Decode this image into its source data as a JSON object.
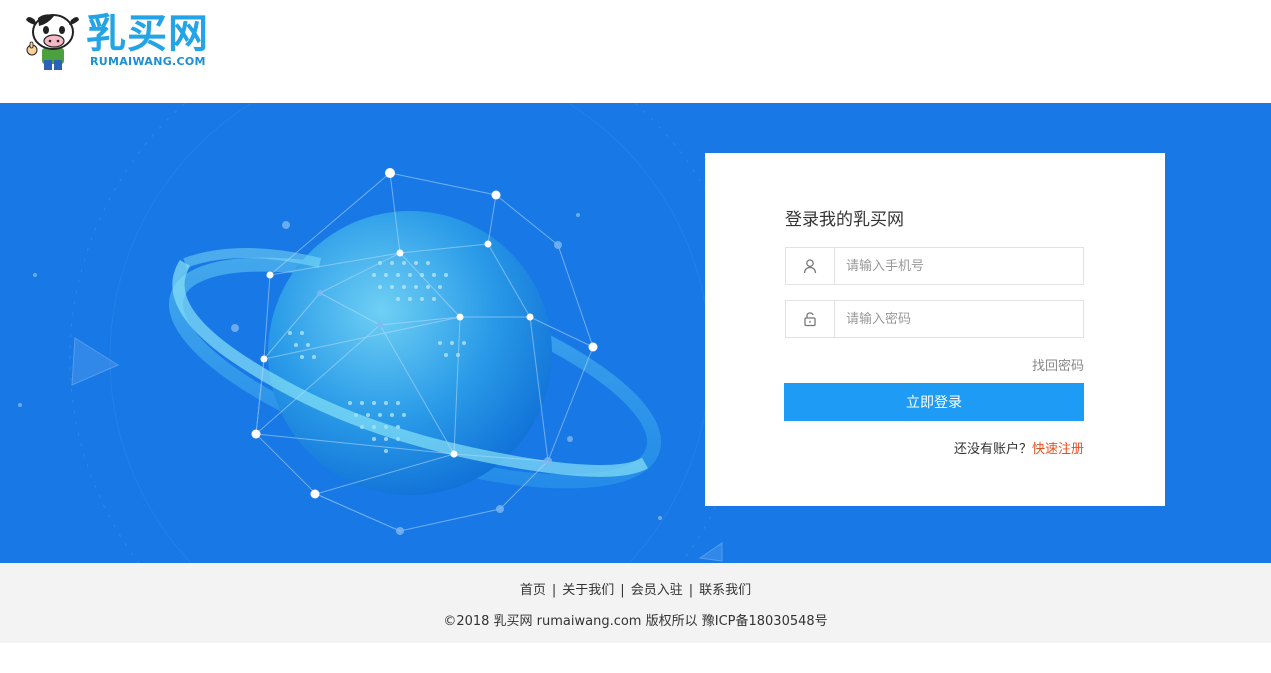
{
  "header": {
    "logo_text": "乳买网",
    "logo_sub": "RUMAIWANG.COM"
  },
  "login": {
    "title": "登录我的乳买网",
    "phone_placeholder": "请输入手机号",
    "password_placeholder": "请输入密码",
    "forgot": "找回密码",
    "submit": "立即登录",
    "no_account": "还没有账户？",
    "register": "快速注册"
  },
  "footer": {
    "nav": [
      "首页",
      "关于我们",
      "会员入驻",
      "联系我们"
    ],
    "copyright": "©2018 乳买网 rumaiwang.com 版权所以 豫ICP备18030548号"
  },
  "colors": {
    "hero_bg": "#1778e6",
    "brand": "#23a4e6",
    "button": "#1e9bf5",
    "register_link": "#e8501e"
  },
  "icons": {
    "phone_field": "user-icon",
    "password_field": "lock-icon"
  }
}
